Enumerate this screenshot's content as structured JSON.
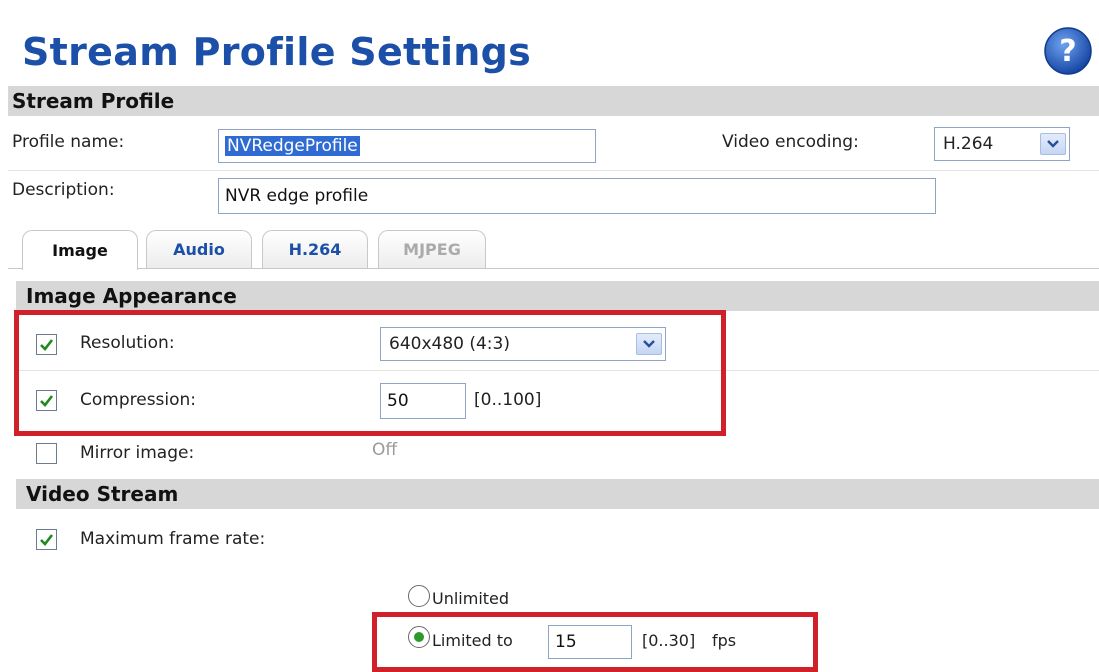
{
  "header": {
    "title": "Stream Profile Settings",
    "help_icon": "question-circle-icon"
  },
  "stream_profile": {
    "section_title": "Stream Profile",
    "profile_name_label": "Profile name:",
    "profile_name_value": "NVRedgeProfile",
    "video_encoding_label": "Video encoding:",
    "video_encoding_value": "H.264",
    "description_label": "Description:",
    "description_value": "NVR edge profile"
  },
  "tabs": [
    {
      "label": "Image",
      "state": "active"
    },
    {
      "label": "Audio",
      "state": "normal"
    },
    {
      "label": "H.264",
      "state": "normal"
    },
    {
      "label": "MJPEG",
      "state": "disabled"
    }
  ],
  "image_appearance": {
    "section_title": "Image Appearance",
    "resolution_label": "Resolution:",
    "resolution_value": "640x480 (4:3)",
    "resolution_checked": true,
    "compression_label": "Compression:",
    "compression_value": "50",
    "compression_range": "[0..100]",
    "compression_checked": true,
    "mirror_label": "Mirror image:",
    "mirror_value": "Off",
    "mirror_checked": false
  },
  "video_stream": {
    "section_title": "Video Stream",
    "max_frame_rate_label": "Maximum frame rate:",
    "max_frame_rate_checked": true,
    "unlimited_label": "Unlimited",
    "limited_label": "Limited to",
    "limited_value": "15",
    "limited_range": "[0..30]",
    "limited_unit": "fps",
    "selected_option": "limited"
  },
  "colors": {
    "title": "#1c4fa8",
    "section_bar": "#d7d7d7",
    "highlight_box": "#d0202a",
    "help_icon": "#1f5fc7"
  }
}
